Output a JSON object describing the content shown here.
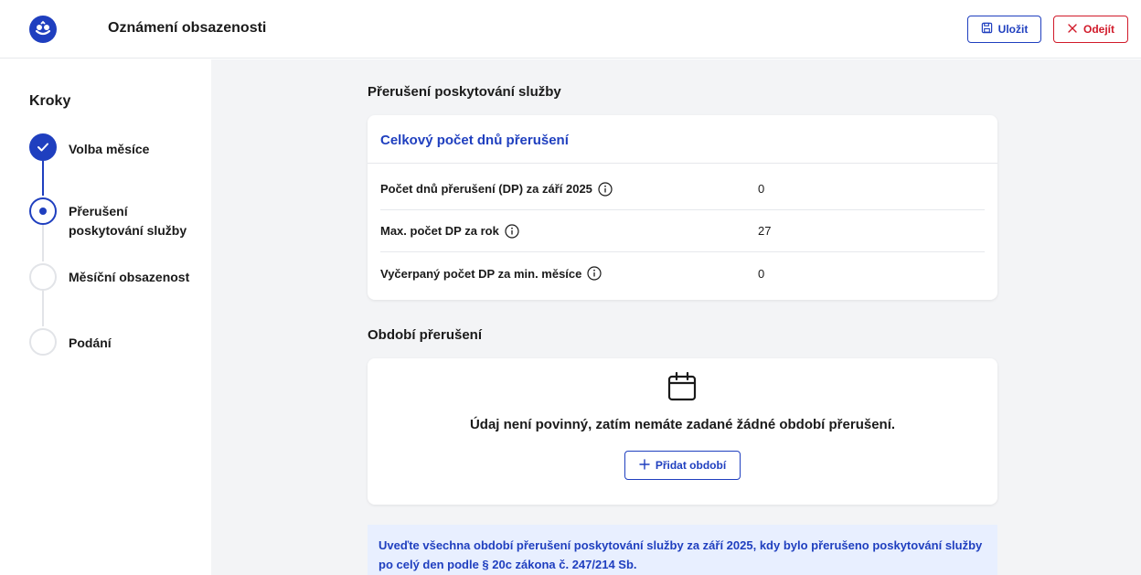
{
  "header": {
    "title": "Oznámení obsazenosti",
    "save_label": "Uložit",
    "exit_label": "Odejít"
  },
  "sidebar": {
    "title": "Kroky",
    "steps": [
      {
        "label": "Volba měsíce",
        "status": "done"
      },
      {
        "label": "Přerušení poskytování služby",
        "status": "current"
      },
      {
        "label": "Měsíční obsazenost",
        "status": "todo"
      },
      {
        "label": "Podání",
        "status": "todo"
      }
    ]
  },
  "main": {
    "section1_title": "Přerušení poskytování služby",
    "summary_card": {
      "heading": "Celkový počet dnů přerušení",
      "rows": [
        {
          "label": "Počet dnů přerušení (DP) za září 2025",
          "value": "0"
        },
        {
          "label": "Max. počet DP za rok",
          "value": "27"
        },
        {
          "label": "Vyčerpaný počet DP za min. měsíce",
          "value": "0"
        }
      ]
    },
    "section2_title": "Období přerušení",
    "empty_state": {
      "text": "Údaj není povinný, zatím nemáte zadané žádné období přerušení.",
      "add_label": "Přidat období"
    },
    "notice": "Uveďte všechna období přerušení poskytování služby za září 2025, kdy bylo přerušeno poskytování služby po celý den podle § 20c zákona č. 247/214 Sb."
  },
  "colors": {
    "accent": "#1f3fbf",
    "danger": "#d11a2a",
    "background": "#f3f4f6",
    "notice_bg": "#e8efff"
  }
}
